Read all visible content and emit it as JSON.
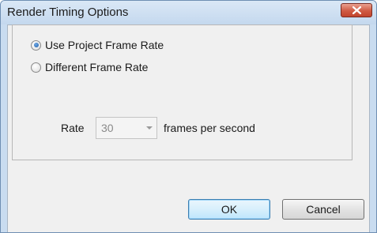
{
  "dialog": {
    "title": "Render Timing Options",
    "close_icon": "close-icon"
  },
  "options": {
    "use_project": {
      "label": "Use Project Frame Rate",
      "checked": true
    },
    "different": {
      "label": "Different Frame Rate",
      "checked": false
    }
  },
  "rate": {
    "label": "Rate",
    "value": "30",
    "units": "frames per second",
    "enabled": false
  },
  "buttons": {
    "ok": "OK",
    "cancel": "Cancel"
  },
  "colors": {
    "titlebar": "#c9dcf0",
    "close_button": "#c2442d",
    "default_button_border": "#3c7fb1"
  }
}
